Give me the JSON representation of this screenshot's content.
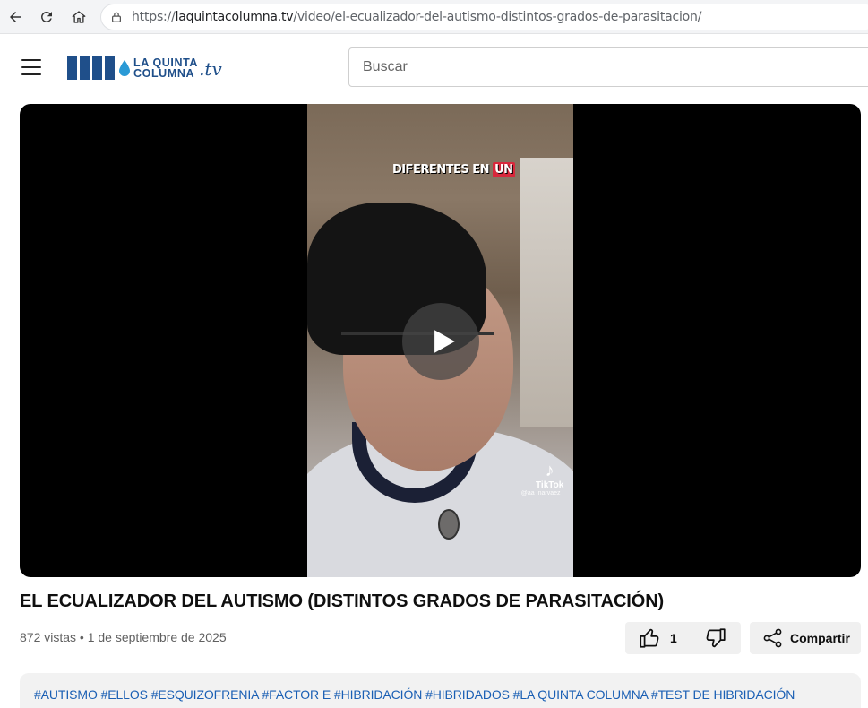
{
  "browser": {
    "url_prefix": "https://",
    "url_host": "laquintacolumna.tv",
    "url_path": "/video/el-ecualizador-del-autismo-distintos-grados-de-parasitacion/"
  },
  "header": {
    "logo_line1": "LA QUINTA",
    "logo_line2": "COLUMNA",
    "logo_suffix": ".tv",
    "search_placeholder": "Buscar"
  },
  "player": {
    "overlay_caption": "DIFERENTES EN",
    "overlay_caption_highlight": "UN",
    "watermark_name": "TikTok",
    "watermark_user": "@aa_narvaez"
  },
  "video": {
    "title": "EL ECUALIZADOR DEL AUTISMO (DISTINTOS GRADOS DE PARASITACIÓN)",
    "meta": "872 vistas • 1 de septiembre de 2025",
    "likes": "1",
    "share_label": "Compartir"
  },
  "tags": [
    "#AUTISMO",
    "#ELLOS",
    "#ESQUIZOFRENIA",
    "#FACTOR E",
    "#HIBRIDACIÓN",
    "#HIBRIDADOS",
    "#LA QUINTA COLUMNA",
    "#TEST DE HIBRIDACIÓN"
  ],
  "colors": {
    "brand": "#1f4f8a",
    "link": "#1a5fb4",
    "caption_highlight": "#d8283c"
  },
  "icons": [
    "back-arrow-icon",
    "reload-icon",
    "home-icon",
    "lock-icon",
    "menu-icon",
    "play-icon",
    "thumbs-up-icon",
    "thumbs-down-icon",
    "share-icon",
    "tiktok-icon"
  ]
}
